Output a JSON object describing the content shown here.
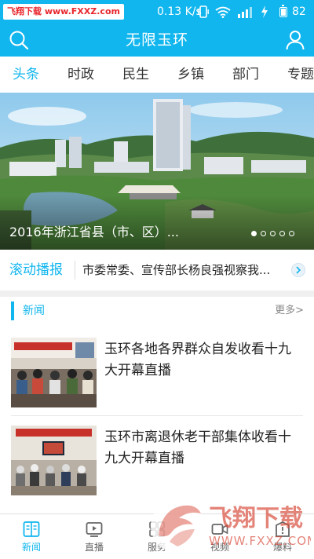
{
  "status_bar": {
    "watermark_text": "飞翔下载 www.FXXZ.com",
    "network_speed": "0.13 K/s",
    "battery": "82",
    "battery_level_pct": 82
  },
  "header": {
    "title": "无限玉环",
    "search_icon": "search-icon",
    "user_icon": "user-icon"
  },
  "tabs": [
    {
      "label": "头条",
      "active": true
    },
    {
      "label": "时政",
      "active": false
    },
    {
      "label": "民生",
      "active": false
    },
    {
      "label": "乡镇",
      "active": false
    },
    {
      "label": "部门",
      "active": false
    },
    {
      "label": "专题",
      "active": false
    }
  ],
  "banner": {
    "caption": "2016年浙江省县（市、区）...",
    "slide_count": 5,
    "active_slide": 1
  },
  "ticker": {
    "label": "滚动播报",
    "text": "市委常委、宣传部长杨良强视察我..."
  },
  "news": {
    "section_title": "新闻",
    "more_label": "更多>",
    "items": [
      {
        "title": "玉环各地各界群众自发收看十九大开幕直播"
      },
      {
        "title": "玉环市离退休老干部集体收看十九大开幕直播"
      }
    ]
  },
  "bottom_nav": [
    {
      "label": "新闻",
      "icon": "news-icon",
      "active": true
    },
    {
      "label": "直播",
      "icon": "live-icon",
      "active": false
    },
    {
      "label": "服务",
      "icon": "service-icon",
      "active": false
    },
    {
      "label": "视频",
      "icon": "video-icon",
      "active": false
    },
    {
      "label": "爆料",
      "icon": "report-icon",
      "active": false
    }
  ],
  "watermark": {
    "brand": "飞翔下载",
    "url": "WWW.FXXZ.COM"
  },
  "colors": {
    "accent": "#11b6ee",
    "header_bg": "#11b6ee",
    "text": "#222222",
    "watermark_red": "#e8262d"
  }
}
